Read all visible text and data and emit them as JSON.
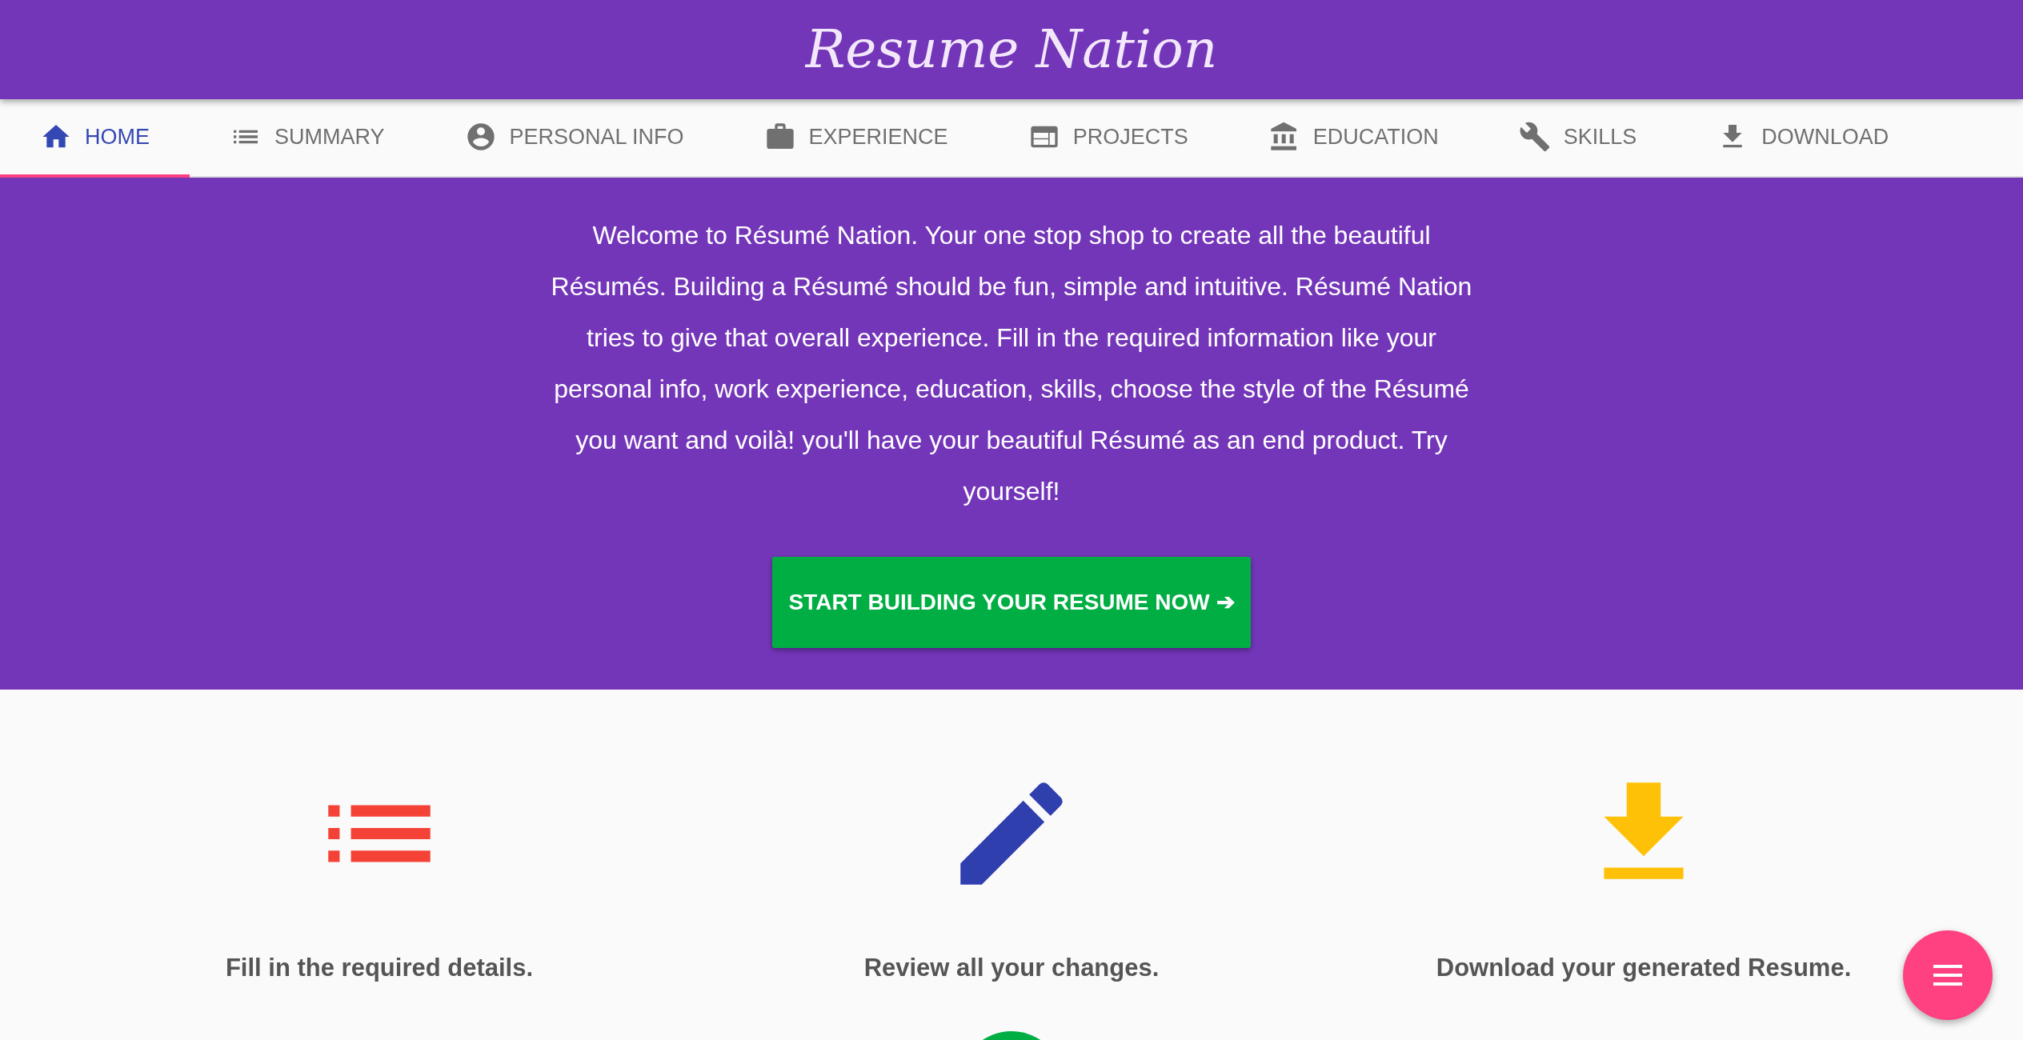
{
  "header": {
    "title": "Resume Nation"
  },
  "tabs": [
    {
      "label": "HOME",
      "kind": "home",
      "selected": true
    },
    {
      "label": "SUMMARY",
      "kind": "list",
      "selected": false
    },
    {
      "label": "PERSONAL INFO",
      "kind": "person",
      "selected": false
    },
    {
      "label": "EXPERIENCE",
      "kind": "briefcase",
      "selected": false
    },
    {
      "label": "PROJECTS",
      "kind": "panel",
      "selected": false
    },
    {
      "label": "EDUCATION",
      "kind": "bank",
      "selected": false
    },
    {
      "label": "SKILLS",
      "kind": "wrench",
      "selected": false
    },
    {
      "label": "DOWNLOAD",
      "kind": "download",
      "selected": false
    }
  ],
  "hero": {
    "text": "Welcome to Résumé Nation. Your one stop shop to create all the beautiful Résumés. Building a Résumé should be fun, simple and intuitive. Résumé Nation tries to give that overall experience. Fill in the required information like your personal info, work experience, education, skills, choose the style of the Résumé you want and voilà! you'll have your beautiful Résumé as an end product. Try yourself!",
    "button": "START BUILDING YOUR RESUME NOW ➔"
  },
  "features": [
    {
      "kind": "list",
      "color": "#f44336",
      "text": "Fill in the required details."
    },
    {
      "kind": "pencil",
      "color": "#303fae",
      "text": "Review all your changes."
    },
    {
      "kind": "download",
      "color": "#ffc107",
      "text": "Download your generated Resume."
    }
  ]
}
